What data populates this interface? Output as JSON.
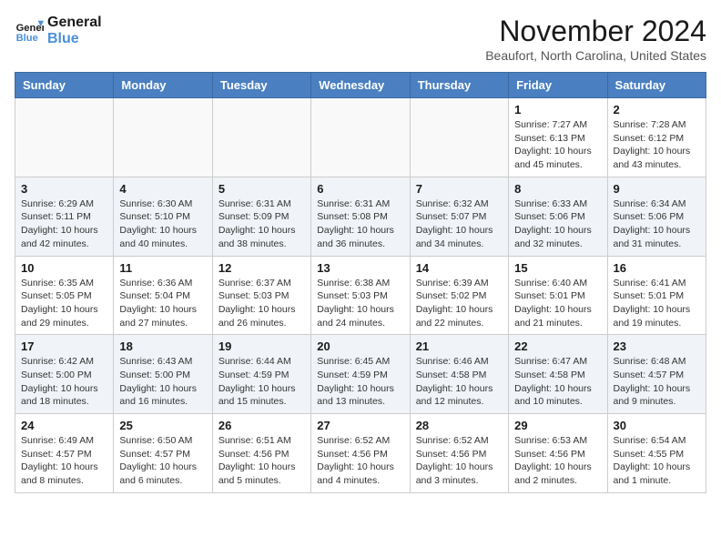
{
  "header": {
    "logo_line1": "General",
    "logo_line2": "Blue",
    "month": "November 2024",
    "location": "Beaufort, North Carolina, United States"
  },
  "days_of_week": [
    "Sunday",
    "Monday",
    "Tuesday",
    "Wednesday",
    "Thursday",
    "Friday",
    "Saturday"
  ],
  "weeks": [
    [
      {
        "day": "",
        "info": ""
      },
      {
        "day": "",
        "info": ""
      },
      {
        "day": "",
        "info": ""
      },
      {
        "day": "",
        "info": ""
      },
      {
        "day": "",
        "info": ""
      },
      {
        "day": "1",
        "info": "Sunrise: 7:27 AM\nSunset: 6:13 PM\nDaylight: 10 hours and 45 minutes."
      },
      {
        "day": "2",
        "info": "Sunrise: 7:28 AM\nSunset: 6:12 PM\nDaylight: 10 hours and 43 minutes."
      }
    ],
    [
      {
        "day": "3",
        "info": "Sunrise: 6:29 AM\nSunset: 5:11 PM\nDaylight: 10 hours and 42 minutes."
      },
      {
        "day": "4",
        "info": "Sunrise: 6:30 AM\nSunset: 5:10 PM\nDaylight: 10 hours and 40 minutes."
      },
      {
        "day": "5",
        "info": "Sunrise: 6:31 AM\nSunset: 5:09 PM\nDaylight: 10 hours and 38 minutes."
      },
      {
        "day": "6",
        "info": "Sunrise: 6:31 AM\nSunset: 5:08 PM\nDaylight: 10 hours and 36 minutes."
      },
      {
        "day": "7",
        "info": "Sunrise: 6:32 AM\nSunset: 5:07 PM\nDaylight: 10 hours and 34 minutes."
      },
      {
        "day": "8",
        "info": "Sunrise: 6:33 AM\nSunset: 5:06 PM\nDaylight: 10 hours and 32 minutes."
      },
      {
        "day": "9",
        "info": "Sunrise: 6:34 AM\nSunset: 5:06 PM\nDaylight: 10 hours and 31 minutes."
      }
    ],
    [
      {
        "day": "10",
        "info": "Sunrise: 6:35 AM\nSunset: 5:05 PM\nDaylight: 10 hours and 29 minutes."
      },
      {
        "day": "11",
        "info": "Sunrise: 6:36 AM\nSunset: 5:04 PM\nDaylight: 10 hours and 27 minutes."
      },
      {
        "day": "12",
        "info": "Sunrise: 6:37 AM\nSunset: 5:03 PM\nDaylight: 10 hours and 26 minutes."
      },
      {
        "day": "13",
        "info": "Sunrise: 6:38 AM\nSunset: 5:03 PM\nDaylight: 10 hours and 24 minutes."
      },
      {
        "day": "14",
        "info": "Sunrise: 6:39 AM\nSunset: 5:02 PM\nDaylight: 10 hours and 22 minutes."
      },
      {
        "day": "15",
        "info": "Sunrise: 6:40 AM\nSunset: 5:01 PM\nDaylight: 10 hours and 21 minutes."
      },
      {
        "day": "16",
        "info": "Sunrise: 6:41 AM\nSunset: 5:01 PM\nDaylight: 10 hours and 19 minutes."
      }
    ],
    [
      {
        "day": "17",
        "info": "Sunrise: 6:42 AM\nSunset: 5:00 PM\nDaylight: 10 hours and 18 minutes."
      },
      {
        "day": "18",
        "info": "Sunrise: 6:43 AM\nSunset: 5:00 PM\nDaylight: 10 hours and 16 minutes."
      },
      {
        "day": "19",
        "info": "Sunrise: 6:44 AM\nSunset: 4:59 PM\nDaylight: 10 hours and 15 minutes."
      },
      {
        "day": "20",
        "info": "Sunrise: 6:45 AM\nSunset: 4:59 PM\nDaylight: 10 hours and 13 minutes."
      },
      {
        "day": "21",
        "info": "Sunrise: 6:46 AM\nSunset: 4:58 PM\nDaylight: 10 hours and 12 minutes."
      },
      {
        "day": "22",
        "info": "Sunrise: 6:47 AM\nSunset: 4:58 PM\nDaylight: 10 hours and 10 minutes."
      },
      {
        "day": "23",
        "info": "Sunrise: 6:48 AM\nSunset: 4:57 PM\nDaylight: 10 hours and 9 minutes."
      }
    ],
    [
      {
        "day": "24",
        "info": "Sunrise: 6:49 AM\nSunset: 4:57 PM\nDaylight: 10 hours and 8 minutes."
      },
      {
        "day": "25",
        "info": "Sunrise: 6:50 AM\nSunset: 4:57 PM\nDaylight: 10 hours and 6 minutes."
      },
      {
        "day": "26",
        "info": "Sunrise: 6:51 AM\nSunset: 4:56 PM\nDaylight: 10 hours and 5 minutes."
      },
      {
        "day": "27",
        "info": "Sunrise: 6:52 AM\nSunset: 4:56 PM\nDaylight: 10 hours and 4 minutes."
      },
      {
        "day": "28",
        "info": "Sunrise: 6:52 AM\nSunset: 4:56 PM\nDaylight: 10 hours and 3 minutes."
      },
      {
        "day": "29",
        "info": "Sunrise: 6:53 AM\nSunset: 4:56 PM\nDaylight: 10 hours and 2 minutes."
      },
      {
        "day": "30",
        "info": "Sunrise: 6:54 AM\nSunset: 4:55 PM\nDaylight: 10 hours and 1 minute."
      }
    ]
  ]
}
